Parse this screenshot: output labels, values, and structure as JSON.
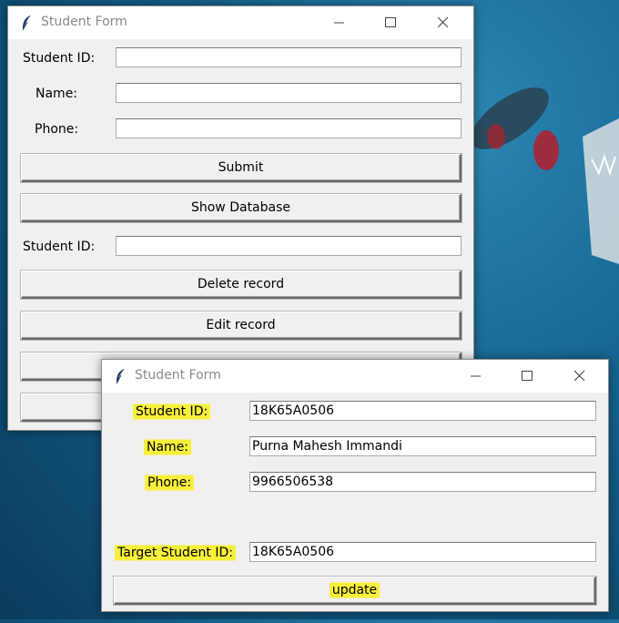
{
  "window_main": {
    "title": "Student Form",
    "labels": {
      "student_id": "Student ID:",
      "name": "Name:",
      "phone": "Phone:",
      "target_id": "Student ID:"
    },
    "values": {
      "student_id": "",
      "name": "",
      "phone": "",
      "target_id": ""
    },
    "buttons": {
      "submit": "Submit",
      "show_db": "Show Database",
      "delete": "Delete record",
      "edit": "Edit record",
      "hidden_1": "",
      "hidden_2": ""
    }
  },
  "window_edit": {
    "title": "Student Form",
    "labels": {
      "student_id": "Student ID:",
      "name": "Name:",
      "phone": "Phone:",
      "target_id": "Target Student ID:"
    },
    "values": {
      "student_id": "18K65A0506",
      "name": "Purna Mahesh Immandi",
      "phone": "9966506538",
      "target_id": "18K65A0506"
    },
    "buttons": {
      "update": "update"
    }
  },
  "colors": {
    "highlight": "#f7ef3a",
    "window_bg": "#f0f0f0",
    "titlebar_text": "#8a8a8a",
    "desktop": "#14628e"
  },
  "icons": {
    "app": "feather-icon",
    "minimize": "minimize-icon",
    "maximize": "maximize-icon",
    "close": "close-icon"
  }
}
